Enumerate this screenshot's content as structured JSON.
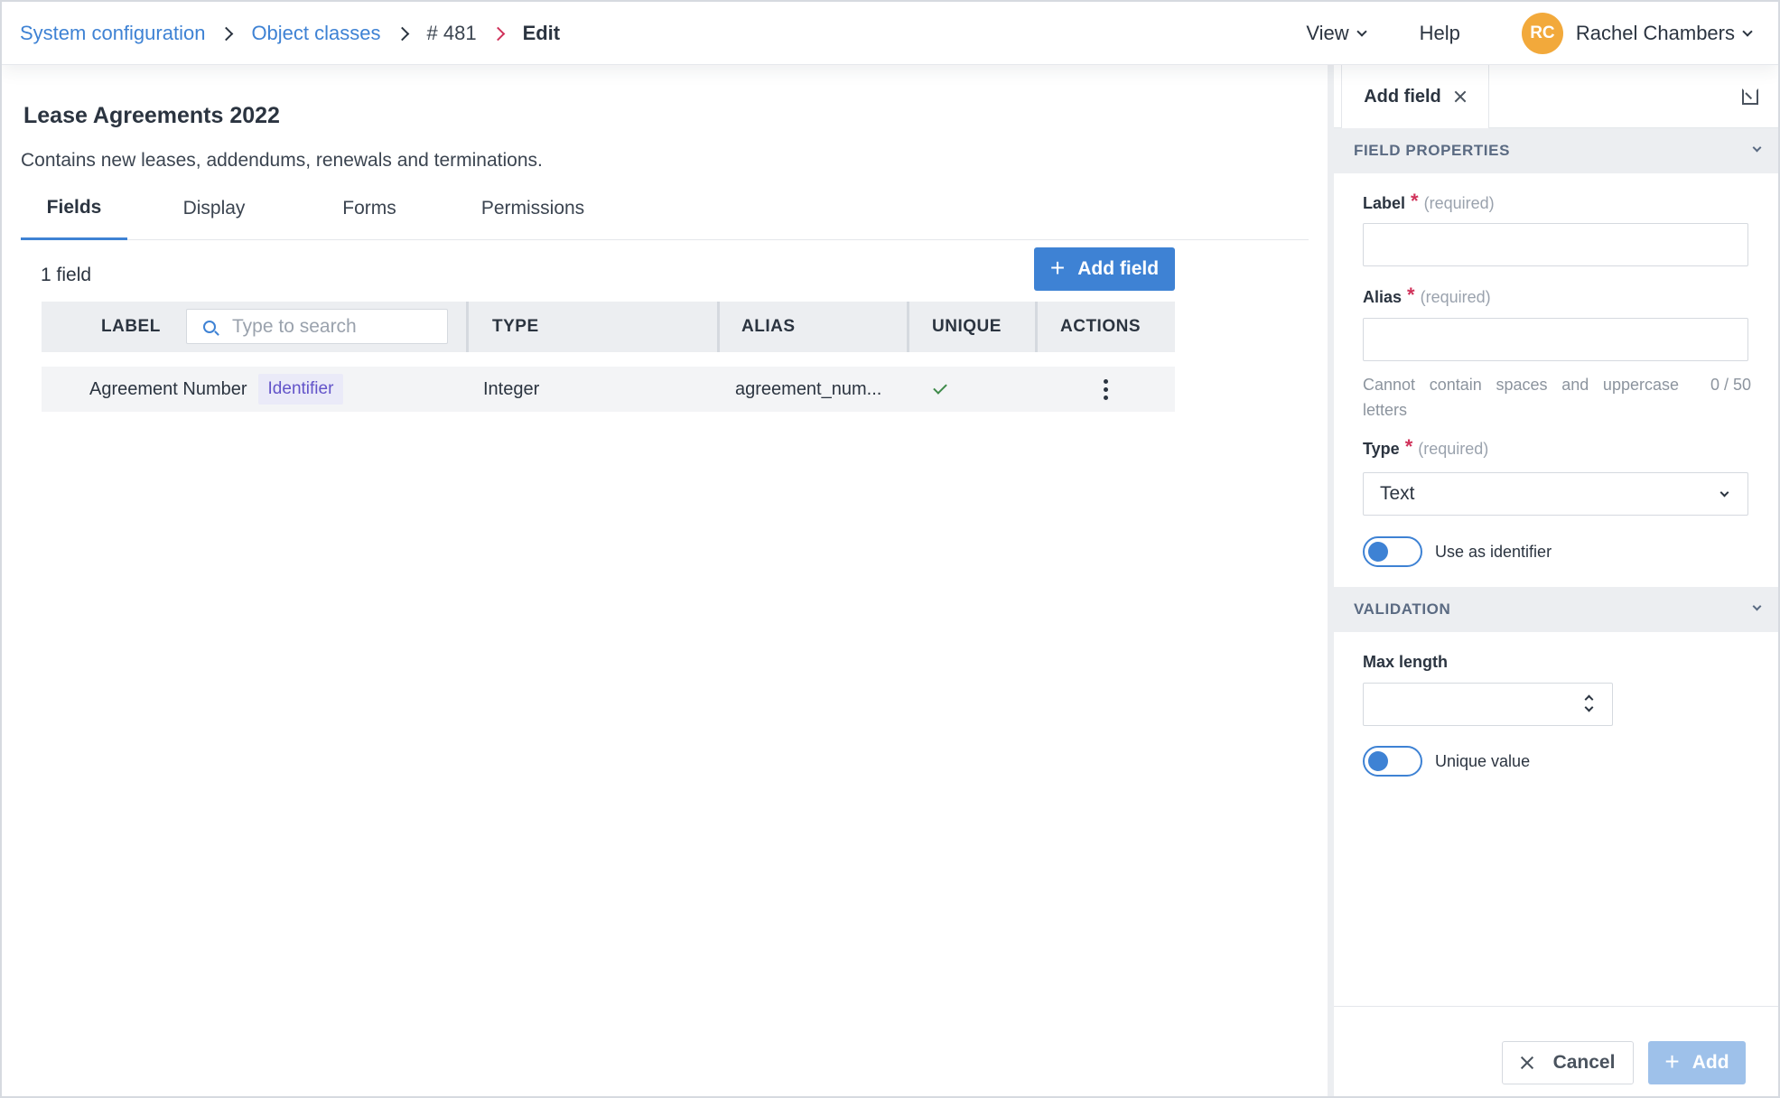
{
  "breadcrumb": {
    "items": [
      "System configuration",
      "Object classes",
      "# 481"
    ],
    "current": "Edit"
  },
  "topnav": {
    "view_label": "View",
    "help_label": "Help",
    "user_initials": "RC",
    "user_name": "Rachel Chambers",
    "avatar_color": "#f2a93b"
  },
  "object": {
    "title": "Lease Agreements 2022",
    "description": "Contains new leases, addendums, renewals and terminations."
  },
  "tabs": [
    {
      "label": "Fields",
      "active": true
    },
    {
      "label": "Display",
      "active": false
    },
    {
      "label": "Forms",
      "active": false
    },
    {
      "label": "Permissions",
      "active": false
    }
  ],
  "fields": {
    "count_label": "1 field",
    "add_button_label": "Add field",
    "search_placeholder": "Type to search",
    "columns": [
      "LABEL",
      "TYPE",
      "ALIAS",
      "UNIQUE",
      "ACTIONS"
    ],
    "rows": [
      {
        "label": "Agreement Number",
        "badge": "Identifier",
        "type": "Integer",
        "alias": "agreement_num...",
        "unique": true
      }
    ]
  },
  "panel": {
    "tab_label": "Add field",
    "field_properties": {
      "heading": "FIELD PROPERTIES",
      "label_label": "Label",
      "alias_label": "Alias",
      "type_label": "Type",
      "required_text": "(required)",
      "alias_hint": "Cannot contain spaces and uppercase letters",
      "alias_counter": "0 / 50",
      "type_value": "Text",
      "use_as_identifier_label": "Use as identifier"
    },
    "validation": {
      "heading": "VALIDATION",
      "max_length_label": "Max length",
      "unique_value_label": "Unique value"
    },
    "cancel_label": "Cancel",
    "add_label": "Add"
  },
  "colors": {
    "accent": "#3e82d4",
    "required": "#d0325a",
    "badge_text": "#6253c9",
    "check": "#3e8a4a"
  }
}
